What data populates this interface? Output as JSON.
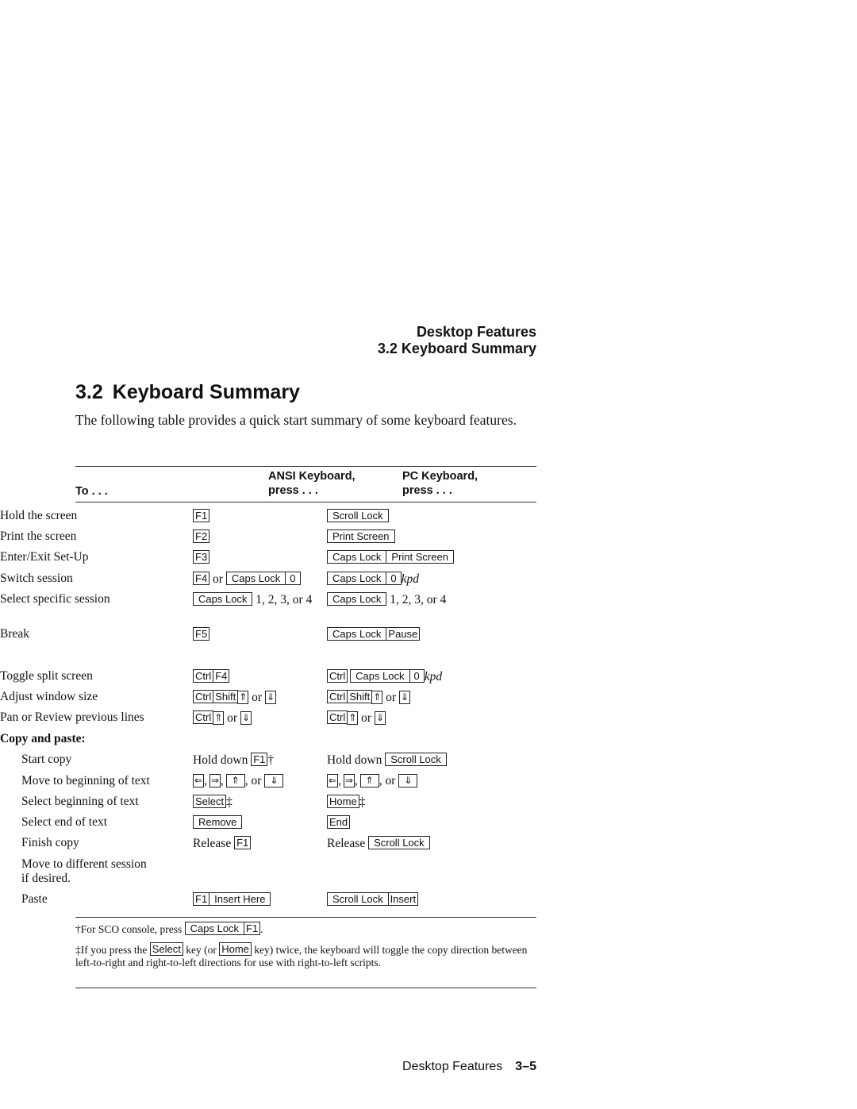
{
  "running_head": {
    "chapter": "Desktop Features",
    "section": "3.2 Keyboard Summary"
  },
  "section": {
    "number": "3.2",
    "title": "Keyboard Summary",
    "intro": "The following table provides a quick start summary of some keyboard features."
  },
  "table": {
    "headers": {
      "col1": "To . . .",
      "col2_line1": "ANSI Keyboard,",
      "col2_line2": "press . . .",
      "col3_line1": "PC Keyboard,",
      "col3_line2": "press . . ."
    },
    "rows": [
      {
        "action": "Hold the screen",
        "ansi": [
          "F1"
        ],
        "pc": [
          "Scroll Lock"
        ]
      },
      {
        "action": "Print the screen",
        "ansi": [
          "F2"
        ],
        "pc": [
          "Print Screen"
        ]
      },
      {
        "action": "Enter/Exit Set-Up",
        "ansi": [
          "F3"
        ],
        "pc": [
          "Caps Lock",
          "Print Screen"
        ]
      },
      {
        "action": "Switch session",
        "ansi_key1": "F4",
        "ansi_or": "or",
        "ansi_combo": [
          "Caps Lock",
          "0"
        ],
        "pc": [
          "Caps Lock",
          "0"
        ],
        "pc_suffix": "kpd"
      },
      {
        "action": "Select specific session",
        "ansi": [
          "Caps Lock"
        ],
        "ansi_suffix": "1, 2, 3, or 4",
        "pc": [
          "Caps Lock"
        ],
        "pc_suffix": "1, 2, 3, or 4"
      },
      {
        "action": "Break",
        "ansi": [
          "F5"
        ],
        "pc": [
          "Caps Lock",
          "Pause"
        ]
      },
      {
        "action": "Toggle split screen",
        "ansi": [
          "Ctrl",
          "F4"
        ],
        "pc_key1": "Ctrl",
        "pc": [
          "Caps Lock",
          "0"
        ],
        "pc_suffix": "kpd"
      },
      {
        "action": "Adjust window size",
        "ansi": [
          "Ctrl",
          "Shift",
          "⇑"
        ],
        "ansi_or": "or",
        "ansi_alt": "⇓",
        "pc": [
          "Ctrl",
          "Shift",
          "⇑"
        ],
        "pc_or": "or",
        "pc_alt": "⇓"
      },
      {
        "action": "Pan or Review previous lines",
        "ansi": [
          "Ctrl",
          "⇑"
        ],
        "ansi_or": "or",
        "ansi_alt": "⇓",
        "pc": [
          "Ctrl",
          "⇑"
        ],
        "pc_or": "or",
        "pc_alt": "⇓"
      }
    ],
    "copy_paste": {
      "heading": "Copy and paste:",
      "rows": [
        {
          "action": "Start copy",
          "ansi_prefix": "Hold down",
          "ansi": [
            "F1"
          ],
          "ansi_mark": "†",
          "pc_prefix": "Hold down",
          "pc": [
            "Scroll Lock"
          ]
        },
        {
          "action": "Move to beginning of text",
          "arrows": [
            "⇐",
            "⇒",
            "⇑",
            "⇓"
          ],
          "or": "or"
        },
        {
          "action": "Select beginning of text",
          "ansi": [
            "Select"
          ],
          "ansi_mark": "‡",
          "pc": [
            "Home"
          ],
          "pc_mark": "‡"
        },
        {
          "action": "Select end of text",
          "ansi": [
            "Remove"
          ],
          "pc": [
            "End"
          ]
        },
        {
          "action": "Finish copy",
          "ansi_prefix": "Release",
          "ansi": [
            "F1"
          ],
          "pc_prefix": "Release",
          "pc": [
            "Scroll Lock"
          ]
        },
        {
          "action_line1": "Move to different session",
          "action_line2": "if desired."
        },
        {
          "action": "Paste",
          "ansi": [
            "F1",
            "Insert Here"
          ],
          "pc": [
            "Scroll Lock",
            "Insert"
          ]
        }
      ]
    }
  },
  "footnotes": {
    "dagger": {
      "mark": "†",
      "text": "For SCO console, press",
      "keys": [
        "Caps Lock",
        "F1"
      ],
      "end": "."
    },
    "ddagger": {
      "mark": "‡",
      "text1": "If you press the",
      "key1": "Select",
      "text2": "key (or",
      "key2": "Home",
      "text3": "key) twice, the keyboard will toggle the copy direction between left-to-right and right-to-left directions for use with right-to-left scripts."
    }
  },
  "page_footer": {
    "chapter": "Desktop Features",
    "page": "3–5"
  }
}
